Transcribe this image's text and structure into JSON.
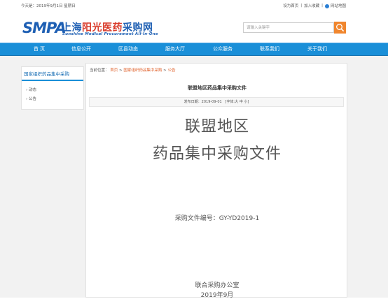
{
  "topbar": {
    "today": "今天是：2019年9月1日 星期日",
    "set_home": "设为首页",
    "separator": "|",
    "add_favorite": "加入收藏",
    "sitemap": "网站地图"
  },
  "header": {
    "logo_smpa": "SMPA",
    "logo_cn_a": "上海",
    "logo_cn_b": "阳光医药",
    "logo_cn_c": "采购网",
    "logo_en": "Sunshine Medical Procurement All-In-One",
    "search_placeholder": "请输入关键字"
  },
  "nav": {
    "items": [
      "首 页",
      "信息公开",
      "区县动态",
      "服务大厅",
      "公众服务",
      "联系我们",
      "关于我们"
    ]
  },
  "sidebar": {
    "title": "国家组织药品集中采购",
    "items": [
      "动态",
      "公告"
    ]
  },
  "breadcrumb": {
    "prefix": "当前位置：",
    "home": "首页",
    "sep": ">",
    "section": "国家组织药品集中采购",
    "current": "公告"
  },
  "article": {
    "title": "联盟地区药品集中采购文件",
    "publish_date": "发布日期：2019-09-01",
    "font_size_label": "[字体:",
    "font_large": "大",
    "font_medium": "中",
    "font_small": "小",
    "font_close": "]",
    "heading_line1": "联盟地区",
    "heading_line2": "药品集中采购文件",
    "doc_number": "采购文件编号：GY-YD2019-1",
    "office": "联合采购办公室",
    "date": "2019年9月"
  },
  "colors": {
    "brand_blue": "#1e5fb3",
    "nav_blue": "#1a8fd8",
    "accent_orange": "#f0862e",
    "link_orange": "#e0602a"
  }
}
